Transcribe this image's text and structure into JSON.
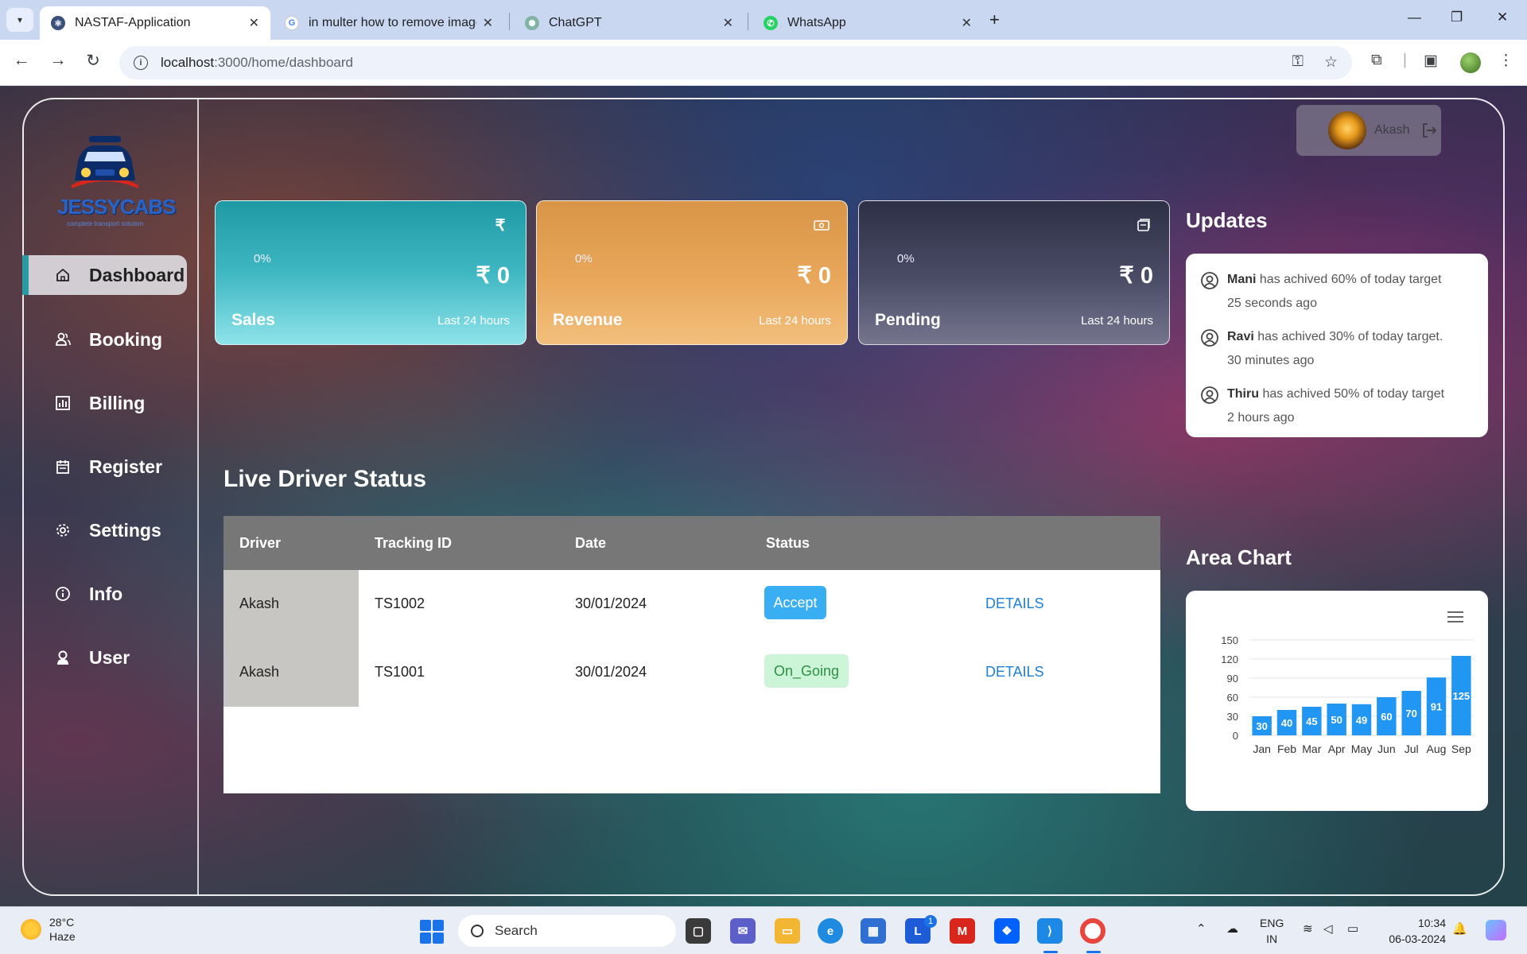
{
  "browser": {
    "tabs": [
      {
        "title": "NASTAF-Application",
        "active": true
      },
      {
        "title": "in multer how to remove image",
        "active": false
      },
      {
        "title": "ChatGPT",
        "active": false
      },
      {
        "title": "WhatsApp",
        "active": false
      }
    ],
    "url_host": "localhost",
    "url_path": ":3000/home/dashboard"
  },
  "logo": {
    "name": "JESSYCABS",
    "tagline": "complete transport solution"
  },
  "sidebar": {
    "items": [
      {
        "label": "Dashboard",
        "icon": "home-icon",
        "active": true
      },
      {
        "label": "Booking",
        "icon": "users-icon",
        "active": false
      },
      {
        "label": "Billing",
        "icon": "bar-chart-icon",
        "active": false
      },
      {
        "label": "Register",
        "icon": "calendar-icon",
        "active": false
      },
      {
        "label": "Settings",
        "icon": "gear-icon",
        "active": false
      },
      {
        "label": "Info",
        "icon": "info-icon",
        "active": false
      },
      {
        "label": "User",
        "icon": "user-icon",
        "active": false
      }
    ]
  },
  "user": {
    "name": "Akash"
  },
  "cards": [
    {
      "label": "Sales",
      "percent": "0%",
      "amount": "₹ 0",
      "period": "Last 24 hours",
      "icon": "rupee-icon",
      "color": "#3fb7c2"
    },
    {
      "label": "Revenue",
      "percent": "0%",
      "amount": "₹ 0",
      "period": "Last 24 hours",
      "icon": "cash-icon",
      "color": "#e9a75b"
    },
    {
      "label": "Pending",
      "percent": "0%",
      "amount": "₹ 0",
      "period": "Last 24 hours",
      "icon": "document-icon",
      "color": "#4b4c66"
    }
  ],
  "updates": {
    "title": "Updates",
    "items": [
      {
        "name": "Mani",
        "text": " has achived 60% of today target",
        "time": "25 seconds ago"
      },
      {
        "name": "Ravi",
        "text": " has achived 30% of today target.",
        "time": "30 minutes ago"
      },
      {
        "name": "Thiru",
        "text": " has achived 50% of today target",
        "time": "2 hours ago"
      }
    ]
  },
  "live_status": {
    "title": "Live Driver Status",
    "columns": [
      "Driver",
      "Tracking ID",
      "Date",
      "Status"
    ],
    "rows": [
      {
        "driver": "Akash",
        "tracking_id": "TS1002",
        "date": "30/01/2024",
        "status": "Accept",
        "action": "DETAILS"
      },
      {
        "driver": "Akash",
        "tracking_id": "TS1001",
        "date": "30/01/2024",
        "status": "On_Going",
        "action": "DETAILS"
      }
    ]
  },
  "area_chart": {
    "title": "Area Chart"
  },
  "chart_data": {
    "type": "bar",
    "title": "",
    "categories": [
      "Jan",
      "Feb",
      "Mar",
      "Apr",
      "May",
      "Jun",
      "Jul",
      "Aug",
      "Sep"
    ],
    "values": [
      30,
      40,
      45,
      50,
      49,
      60,
      70,
      91,
      125
    ],
    "yticks": [
      0,
      30,
      60,
      90,
      120,
      150
    ],
    "ylim": [
      0,
      150
    ],
    "color": "#2196f3",
    "grid": true
  },
  "taskbar": {
    "weather_temp": "28°C",
    "weather_desc": "Haze",
    "search_placeholder": "Search",
    "lang_top": "ENG",
    "lang_bottom": "IN",
    "time": "10:34",
    "date": "06-03-2024",
    "teams_badge": "1"
  }
}
